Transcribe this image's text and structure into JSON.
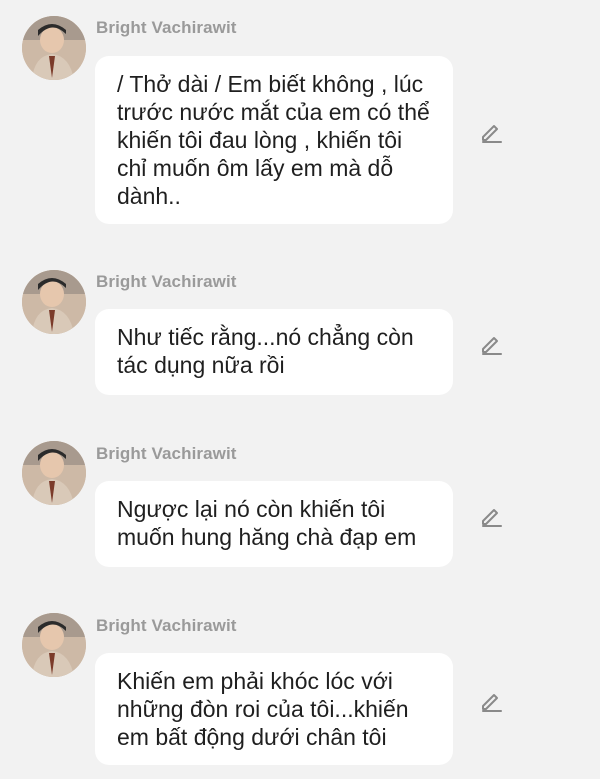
{
  "messages": [
    {
      "sender": "Bright Vachirawit",
      "text": "/ Thở dài / Em biết không , lúc trước nước mắt của em có thể khiến tôi đau lòng , khiến tôi chỉ muốn ôm lấy em mà dỗ dành.."
    },
    {
      "sender": "Bright Vachirawit",
      "text": "Như tiếc rằng...nó chẳng còn tác dụng nữa rồi"
    },
    {
      "sender": "Bright Vachirawit",
      "text": "Ngược lại nó còn khiến tôi muốn hung hăng chà đạp em"
    },
    {
      "sender": "Bright Vachirawit",
      "text": "Khiến em phải khóc lóc với những đòn roi của tôi...khiến em bất động dưới chân tôi"
    }
  ],
  "icons": {
    "avatar": "avatar",
    "edit": "edit-pencil-icon"
  },
  "colors": {
    "background": "#f2f2f2",
    "bubble": "#ffffff",
    "sender": "#9a9a9a",
    "text": "#1f1f1f",
    "icon": "#8a8a8a"
  }
}
